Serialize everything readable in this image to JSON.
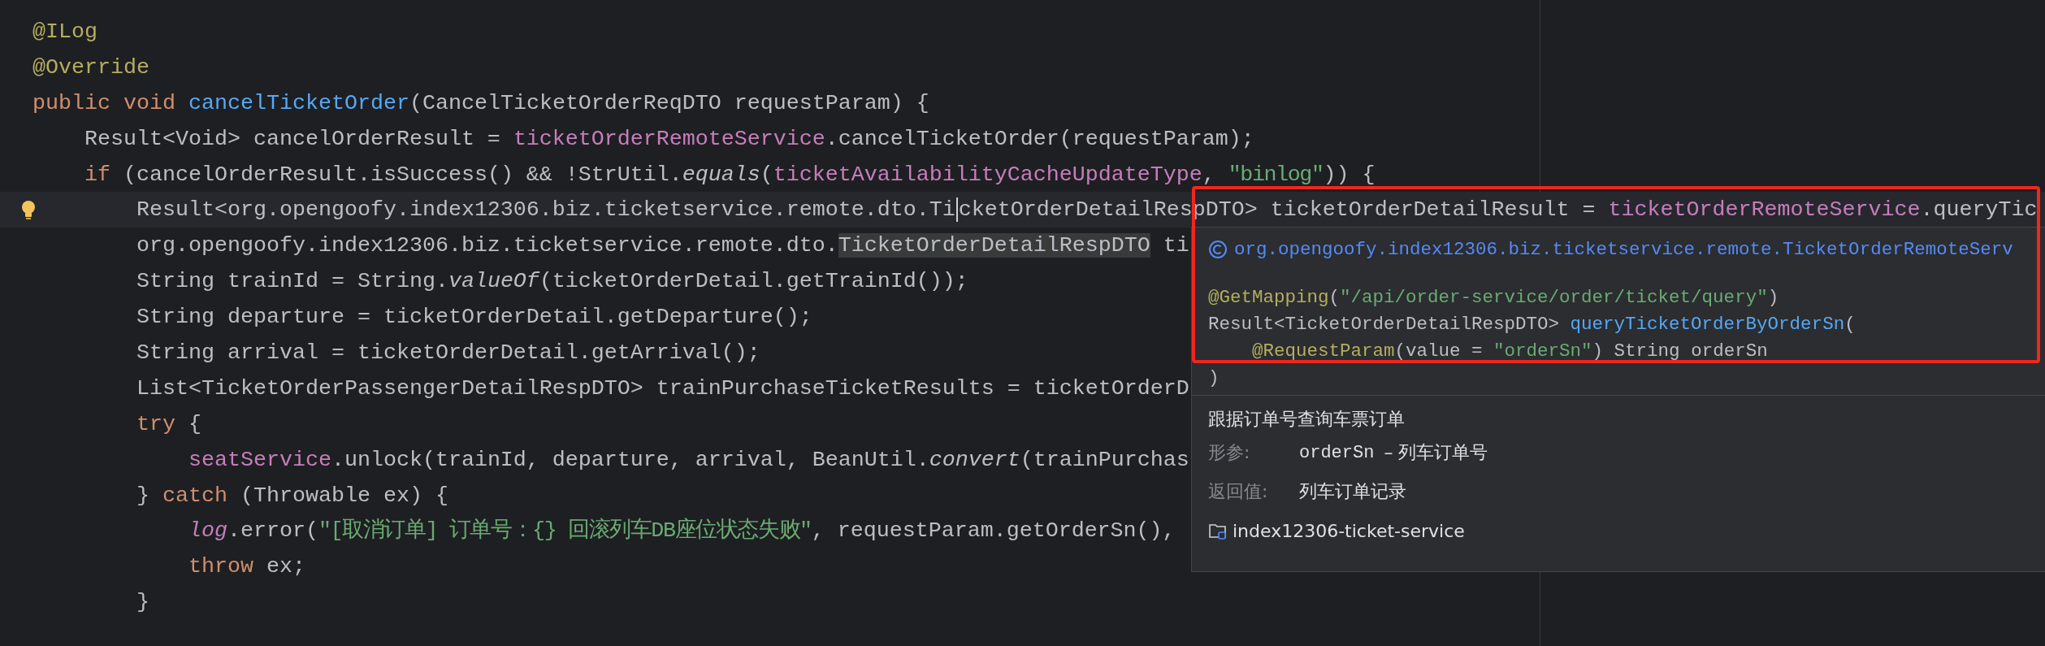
{
  "editor": {
    "lines": [
      {
        "current": false,
        "tokens": [
          {
            "text": "@ILog",
            "kind": "annotation"
          }
        ]
      },
      {
        "current": false,
        "tokens": [
          {
            "text": "@Override",
            "kind": "annotation"
          }
        ]
      },
      {
        "current": false,
        "tokens": [
          {
            "text": "public void ",
            "kind": "keyword"
          },
          {
            "text": "cancelTicketOrder",
            "kind": "method"
          },
          {
            "text": "(CancelTicketOrderReqDTO requestParam) {",
            "kind": "plain"
          }
        ]
      },
      {
        "current": false,
        "tokens": [
          {
            "text": "    Result<Void> cancelOrderResult = ",
            "kind": "plain"
          },
          {
            "text": "ticketOrderRemoteService",
            "kind": "field"
          },
          {
            "text": ".cancelTicketOrder(requestParam);",
            "kind": "plain"
          }
        ]
      },
      {
        "current": false,
        "tokens": [
          {
            "text": "    if ",
            "kind": "keyword"
          },
          {
            "text": "(cancelOrderResult.isSuccess() && !StrUtil.",
            "kind": "plain"
          },
          {
            "text": "equals",
            "kind": "static"
          },
          {
            "text": "(",
            "kind": "plain"
          },
          {
            "text": "ticketAvailabilityCacheUpdateType",
            "kind": "field"
          },
          {
            "text": ", ",
            "kind": "plain"
          },
          {
            "text": "\"binlog\"",
            "kind": "string"
          },
          {
            "text": ")) {",
            "kind": "plain"
          }
        ]
      },
      {
        "current": true,
        "tokens": [
          {
            "text": "        Result<org.opengoofy.index12306.biz.ticketservice.remote.dto.Ti",
            "kind": "plain"
          },
          {
            "text": "cketOrderDetailRespDTO> ticketOrderDetailResult = ",
            "kind": "caret"
          },
          {
            "text": "ticketOrderRemoteService",
            "kind": "field"
          },
          {
            "text": ".queryTic",
            "kind": "plain"
          }
        ]
      },
      {
        "current": false,
        "tokens": [
          {
            "text": "        org.opengoofy.index12306.biz.ticketservice.remote.dto.",
            "kind": "plain"
          },
          {
            "text": "TicketOrderDetailRespDTO",
            "kind": "usage"
          },
          {
            "text": " ti",
            "kind": "plain"
          }
        ]
      },
      {
        "current": false,
        "tokens": [
          {
            "text": "        String trainId = String.",
            "kind": "plain"
          },
          {
            "text": "valueOf",
            "kind": "static"
          },
          {
            "text": "(ticketOrderDetail.getTrainId());",
            "kind": "plain"
          }
        ]
      },
      {
        "current": false,
        "tokens": [
          {
            "text": "        String departure = ticketOrderDetail.getDeparture();",
            "kind": "plain"
          }
        ]
      },
      {
        "current": false,
        "tokens": [
          {
            "text": "        String arrival = ticketOrderDetail.getArrival();",
            "kind": "plain"
          }
        ]
      },
      {
        "current": false,
        "tokens": [
          {
            "text": "        List<TicketOrderPassengerDetailRespDTO> trainPurchaseTicketResults = ticketOrderD",
            "kind": "plain"
          }
        ]
      },
      {
        "current": false,
        "tokens": [
          {
            "text": "        try",
            "kind": "keyword"
          },
          {
            "text": " {",
            "kind": "plain"
          }
        ]
      },
      {
        "current": false,
        "tokens": [
          {
            "text": "            seatService",
            "kind": "field"
          },
          {
            "text": ".unlock(trainId, departure, arrival, BeanUtil.",
            "kind": "plain"
          },
          {
            "text": "convert",
            "kind": "static"
          },
          {
            "text": "(trainPurchas",
            "kind": "plain"
          }
        ]
      },
      {
        "current": false,
        "tokens": [
          {
            "text": "        } ",
            "kind": "plain"
          },
          {
            "text": "catch",
            "kind": "keyword"
          },
          {
            "text": " (Throwable ex) {",
            "kind": "plain"
          }
        ]
      },
      {
        "current": false,
        "tokens": [
          {
            "text": "            log",
            "kind": "static-field"
          },
          {
            "text": ".error(",
            "kind": "plain"
          },
          {
            "text": "\"[取消订单] 订单号：{} 回滚列车DB座位状态失败\"",
            "kind": "string"
          },
          {
            "text": ", requestParam.getOrderSn(),",
            "kind": "plain"
          }
        ]
      },
      {
        "current": false,
        "tokens": [
          {
            "text": "            throw",
            "kind": "keyword"
          },
          {
            "text": " ex;",
            "kind": "plain"
          }
        ]
      },
      {
        "current": false,
        "tokens": [
          {
            "text": "        }",
            "kind": "plain"
          }
        ]
      }
    ]
  },
  "popup": {
    "class_name": "org.opengoofy.index12306.biz.ticketservice.remote.TicketOrderRemoteServ",
    "signature": [
      [
        {
          "text": "@GetMapping",
          "kind": "annotation"
        },
        {
          "text": "(",
          "kind": "plain"
        },
        {
          "text": "\"/api/order-service/order/ticket/query\"",
          "kind": "string"
        },
        {
          "text": ")",
          "kind": "plain"
        }
      ],
      [
        {
          "text": "Result<TicketOrderDetailRespDTO> ",
          "kind": "plain"
        },
        {
          "text": "queryTicketOrderByOrderSn",
          "kind": "method"
        },
        {
          "text": "(",
          "kind": "plain"
        }
      ],
      [
        {
          "text": "    @RequestParam",
          "kind": "annotation"
        },
        {
          "text": "(value = ",
          "kind": "plain"
        },
        {
          "text": "\"orderSn\"",
          "kind": "string"
        },
        {
          "text": ") String orderSn",
          "kind": "plain"
        }
      ],
      [
        {
          "text": ")",
          "kind": "plain"
        }
      ]
    ],
    "description": "跟据订单号查询车票订单",
    "params_label": "形参:",
    "param_name": "orderSn",
    "param_text": "– 列车订单号",
    "returns_label": "返回值:",
    "returns_text": "列车订单记录",
    "module": "index12306-ticket-service"
  },
  "highlight_frame": true
}
